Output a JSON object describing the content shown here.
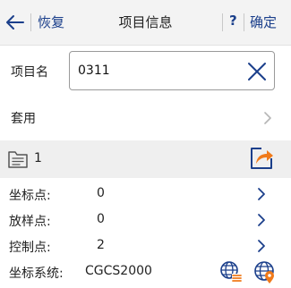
{
  "header": {
    "left_label": "恢复",
    "title": "项目信息",
    "help": "?",
    "right_label": "确定"
  },
  "project_name": {
    "label": "项目名",
    "value": "0311"
  },
  "apply": {
    "label": "套用"
  },
  "section": {
    "number": "1"
  },
  "stats": [
    {
      "label": "坐标点:",
      "value": "0"
    },
    {
      "label": "放样点:",
      "value": "0"
    },
    {
      "label": "控制点:",
      "value": "2"
    }
  ],
  "coordinate_system": {
    "label": "坐标系统:",
    "value": "CGCS2000"
  },
  "colors": {
    "accent_blue": "#1b3f8b",
    "share_orange": "#f07a1a",
    "header_bg": "#f3f3f3",
    "section_bg": "#efefef"
  },
  "icons": [
    "back-arrow-icon",
    "clear-icon",
    "chevron-right-icon",
    "folder-icon",
    "share-icon",
    "globe-list-icon",
    "globe-pin-icon"
  ]
}
